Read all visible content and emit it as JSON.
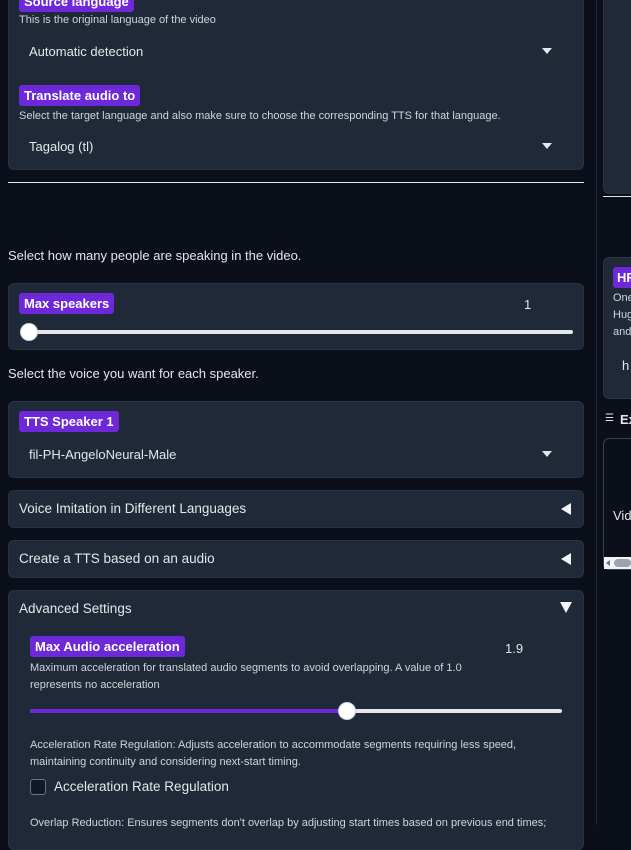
{
  "source_language": {
    "label": "Source language",
    "info": "This is the original language of the video",
    "value": "Automatic detection"
  },
  "translate_audio": {
    "label": "Translate audio to",
    "info": "Select the target language and also make sure to choose the corresponding TTS for that language.",
    "value": "Tagalog (tl)"
  },
  "speakers_prompt": "Select how many people are speaking in the video.",
  "max_speakers": {
    "label": "Max speakers",
    "value": "1",
    "level": 0.0
  },
  "voice_prompt": "Select the voice you want for each speaker.",
  "tts_speaker": {
    "label": "TTS Speaker 1",
    "value": "fil-PH-AngeloNeural-Male"
  },
  "accordions": {
    "voice_imitation": "Voice Imitation in Different Languages",
    "create_tts": "Create a TTS based on an audio",
    "advanced": "Advanced Settings"
  },
  "max_audio_accel": {
    "label": "Max Audio acceleration",
    "value": "1.9",
    "info_line1": "Maximum acceleration for translated audio segments to avoid overlapping. A value of 1.0",
    "info_line2": "represents no acceleration",
    "level": 0.6
  },
  "accel_regulation": {
    "desc_line1": "Acceleration Rate Regulation: Adjusts acceleration to accommodate segments requiring less speed,",
    "desc_line2": "maintaining continuity and considering next-start timing.",
    "checkbox_label": "Acceleration Rate Regulation",
    "checked": false
  },
  "overlap_desc": "Overlap Reduction: Ensures segments don't overlap by adjusting start times based on previous end times;",
  "right_column": {
    "badge": "HF",
    "line1": "One",
    "line2": "Hug",
    "line3": "and",
    "field_value": "h",
    "examples_label": "Ex",
    "cell_text": "Vid"
  },
  "colors": {
    "background": "#0b0f19",
    "panel": "#1f2937",
    "accent": "#6d28d9"
  }
}
